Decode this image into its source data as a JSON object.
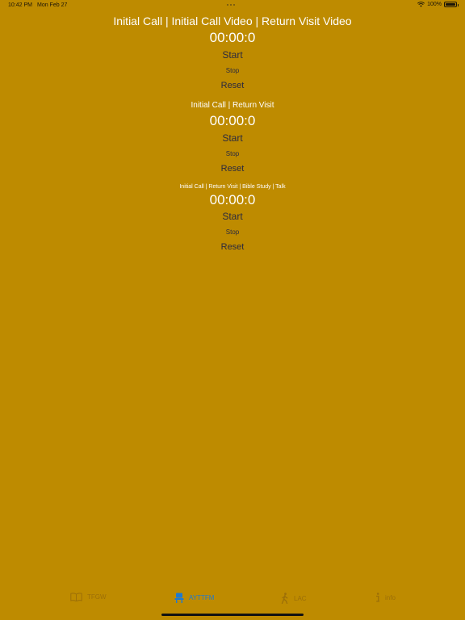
{
  "status_bar": {
    "time": "10:42 PM",
    "date": "Mon Feb 27",
    "battery": "100%",
    "battery_level": 1.0
  },
  "timers": [
    {
      "title": "Initial Call | Initial Call Video | Return Visit Video",
      "display": "00:00:0",
      "start_label": "Start",
      "stop_label": "Stop",
      "reset_label": "Reset"
    },
    {
      "title": "Initial Call | Return Visit",
      "display": "00:00:0",
      "start_label": "Start",
      "stop_label": "Stop",
      "reset_label": "Reset"
    },
    {
      "title": "Initial Call | Return Visit | Bible Study | Talk",
      "display": "00:00:0",
      "start_label": "Start",
      "stop_label": "Stop",
      "reset_label": "Reset"
    }
  ],
  "tab_bar": {
    "tabs": [
      {
        "label": "TFGW",
        "icon": "book-icon"
      },
      {
        "label": "AYTTFM",
        "icon": "seat-icon",
        "active": true
      },
      {
        "label": "LAC",
        "icon": "walking-icon"
      },
      {
        "label": "info",
        "icon": "info-icon"
      }
    ]
  },
  "colors": {
    "background": "#BE8B00",
    "accent": "#1E7AD0",
    "inactive_tab": "#9C6F08",
    "title_text": "#FFFFFF",
    "button_text": "#2B2A3E"
  }
}
